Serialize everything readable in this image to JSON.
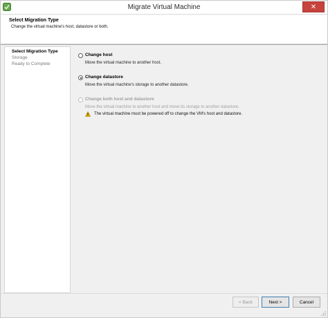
{
  "window": {
    "title": "Migrate Virtual Machine",
    "close_glyph": "✕"
  },
  "header": {
    "title": "Select Migration Type",
    "subtitle": "Change the virtual machine's host, datastore or both."
  },
  "nav": {
    "items": [
      {
        "label": "Select Migration Type",
        "active": true
      },
      {
        "label": "Storage",
        "active": false
      },
      {
        "label": "Ready to Complete",
        "active": false
      }
    ]
  },
  "options": [
    {
      "label": "Change host",
      "description": "Move the virtual machine to another host.",
      "selected": false,
      "enabled": true
    },
    {
      "label": "Change datastore",
      "description": "Move the virtual machine's storage to another datastore.",
      "selected": true,
      "enabled": true
    },
    {
      "label": "Change both host and datastore",
      "description": "Move the virtual machine to another host and move its storage to another datastore.",
      "selected": false,
      "enabled": false
    }
  ],
  "warning": {
    "text": "The virtual machine must be powered off to change the VM's host and datastore."
  },
  "buttons": {
    "back": "< Back",
    "next": "Next >",
    "cancel": "Cancel"
  },
  "colors": {
    "close_button": "#c7433d",
    "warning": "#e8b800"
  }
}
